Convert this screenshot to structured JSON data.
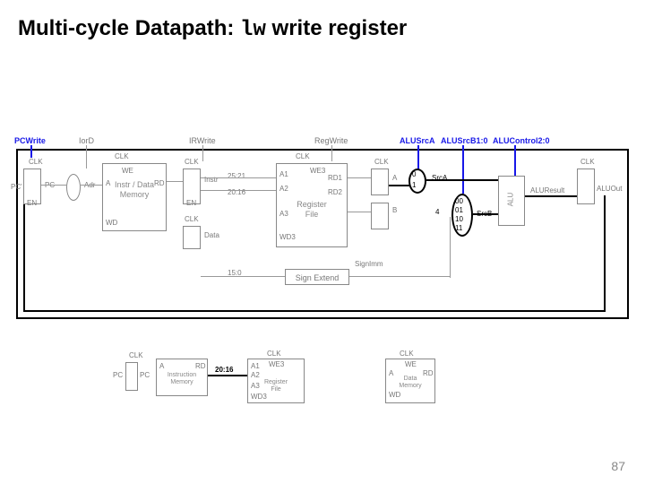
{
  "title_pre": "Multi-cycle Datapath: ",
  "title_mono": "lw",
  "title_post": " write register",
  "page_number": "87",
  "ctrl": {
    "pcwrite": "PCWrite",
    "iord": "IorD",
    "irwrite": "IRWrite",
    "regwrite": "RegWrite",
    "alusrca": "ALUSrcA",
    "alusrcb": "ALUSrcB1:0",
    "alucontrol": "ALUControl2:0"
  },
  "labels": {
    "clk": "CLK",
    "pc_pin": "PC'",
    "pc": "PC",
    "en": "EN",
    "adr": "Adr",
    "we": "WE",
    "a": "A",
    "rd": "RD",
    "wd": "WD",
    "instr_mem": "Instr / Data\nMemory",
    "instr": "Instr",
    "data": "Data",
    "bits_25_21": "25:21",
    "bits_20_16": "20:16",
    "bits_15_0": "15:0",
    "a1": "A1",
    "a2": "A2",
    "a3": "A3",
    "we3": "WE3",
    "rd1": "RD1",
    "rd2": "RD2",
    "wd3": "WD3",
    "regfile": "Register\nFile",
    "srcA": "SrcA",
    "srcB": "SrcB",
    "four": "4",
    "mux00": "00",
    "mux01": "01",
    "mux10": "10",
    "mux11": "11",
    "alu": "ALU",
    "aluresult": "ALUResult",
    "aluout": "ALUOut",
    "signext": "Sign Extend",
    "signimm": "SignImm",
    "b_reg": "B"
  },
  "mini": {
    "pc": "PC",
    "instr_mem": "Instruction\nMemory",
    "regfile": "Register\nFile",
    "data_mem": "Data\nMemory",
    "a1": "A1",
    "a2": "A2",
    "a3": "A3",
    "wd3": "WD3",
    "we3": "WE3",
    "rd": "RD",
    "we": "WE",
    "wd": "WD",
    "a": "A",
    "bits": "20:16"
  }
}
